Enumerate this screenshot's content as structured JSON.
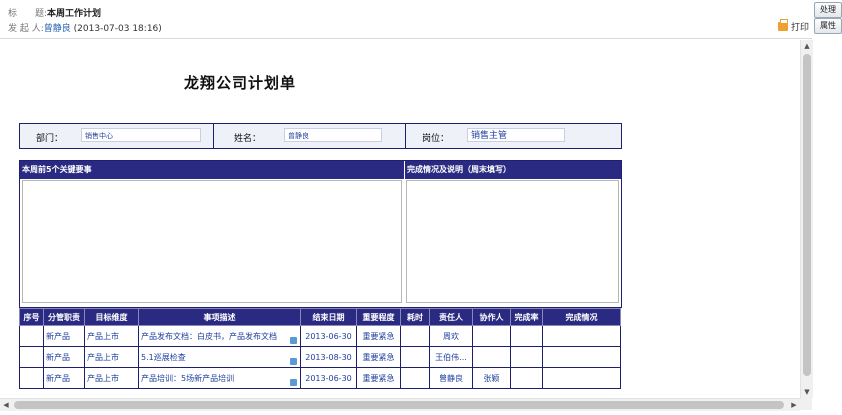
{
  "header": {
    "subject_label": "标　　题:",
    "subject": "本周工作计划",
    "sender_label": "发 起 人:",
    "sender_name": "曾静良",
    "sender_time": "(2013-07-03 18:16)",
    "print_label": "打印"
  },
  "side_buttons": {
    "process": "处理",
    "properties": "属性"
  },
  "form": {
    "title": "龙翔公司计划单",
    "dept_label": "部门：",
    "dept_value": "销售中心",
    "name_label": "姓名：",
    "name_value": "曾静良",
    "post_label": "岗位：",
    "post_value": "销售主管",
    "section_left": "本周前5个关键要事",
    "section_right": "完成情况及说明（周末填写）"
  },
  "table": {
    "headers": [
      "序号",
      "分管职责",
      "目标维度",
      "事项描述",
      "结束日期",
      "重要程度",
      "耗时",
      "责任人",
      "协作人",
      "完成率",
      "完成情况"
    ],
    "rows": [
      [
        "",
        "新产品",
        "产品上市",
        "产品发布文档：白皮书，产品发布文档",
        "2013-06-30",
        "重要紧急",
        "",
        "周欢",
        "",
        "",
        ""
      ],
      [
        "",
        "新产品",
        "产品上市",
        "5.1巡展检查",
        "2013-08-30",
        "重要紧急",
        "",
        "王伯伟...",
        "",
        "",
        ""
      ],
      [
        "",
        "新产品",
        "产品上市",
        "产品培训：5场新产品培训",
        "2013-06-30",
        "重要紧急",
        "",
        "曾静良",
        "张颖",
        "",
        ""
      ]
    ]
  },
  "scroll": {
    "up": "▲",
    "down": "▼",
    "left": "◀",
    "right": "▶"
  },
  "colors": {
    "header_bar": "#2a2a82",
    "link_blue": "#1f3f9f",
    "info_bg": "#eef1f8"
  }
}
